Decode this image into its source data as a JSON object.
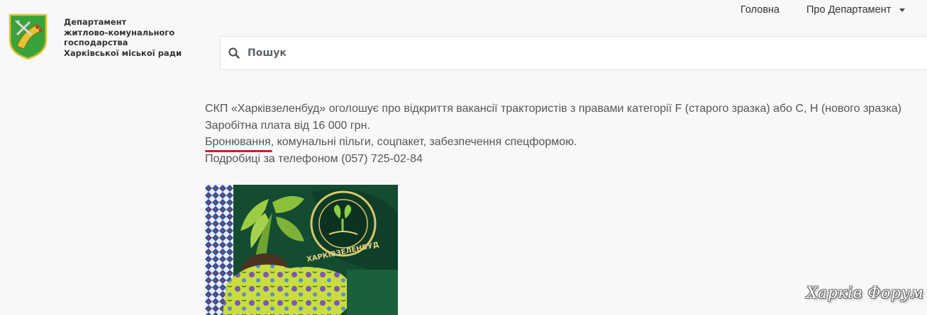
{
  "header": {
    "org_lines": [
      "Департамент",
      "житлово-комунального",
      "господарства",
      "Харківської міської ради"
    ],
    "nav": {
      "home": "Головна",
      "about": "Про Департамент"
    }
  },
  "search": {
    "placeholder": "Пошук",
    "value": ""
  },
  "article": {
    "line1": "СКП «Харківзеленбуд» оголошує про відкриття вакансії трактористів з правами категорії F (старого зразка) або С, Н (нового зразка)",
    "line2": "Заробітна плата від 16 000 грн.",
    "line3_highlight": "Бронювання",
    "line3_rest": ", комунальні пільги, соцпакет, забезпечення спецформою.",
    "line4": "Подробиці за телефоном (057) 725-02-84"
  },
  "photo": {
    "patch_text": "ХАРКІВЗЕЛЕНБУД"
  },
  "watermark": "Харків Форум",
  "colors": {
    "underline": "#d21e22",
    "logo_green": "#3aa23a",
    "logo_gold": "#e7c12e"
  }
}
